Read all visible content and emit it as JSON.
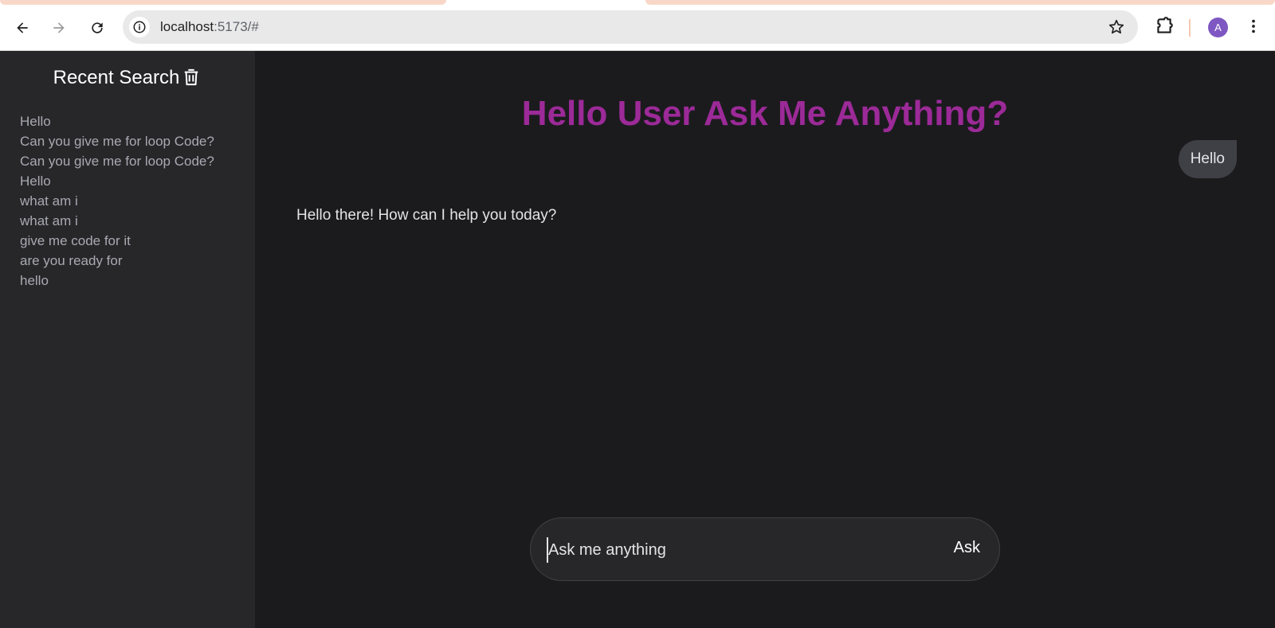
{
  "browser": {
    "url_host": "localhost",
    "url_rest": ":5173/#",
    "avatar_letter": "A",
    "icons": [
      "back-icon",
      "forward-icon",
      "reload-icon",
      "site-info-icon",
      "bookmark-star-icon",
      "extensions-icon",
      "profile-avatar",
      "more-menu-icon"
    ]
  },
  "sidebar": {
    "title": "Recent Search",
    "items": [
      "Hello",
      "Can you give me for loop Code?",
      "Can you give me for loop Code?",
      "Hello",
      "what am i",
      "what am i",
      "give me code for it",
      "are you ready for",
      "hello"
    ]
  },
  "main": {
    "heading": "Hello User Ask Me Anything?",
    "user_message": "Hello",
    "bot_reply": "Hello there! How can I help you today?"
  },
  "composer": {
    "placeholder": "Ask me anything",
    "ask_label": "Ask"
  },
  "colors": {
    "heading": "#9c2a98",
    "sidebar_bg": "#27272a",
    "main_bg": "#1b1b1d",
    "bubble_bg": "#3f3f46"
  }
}
